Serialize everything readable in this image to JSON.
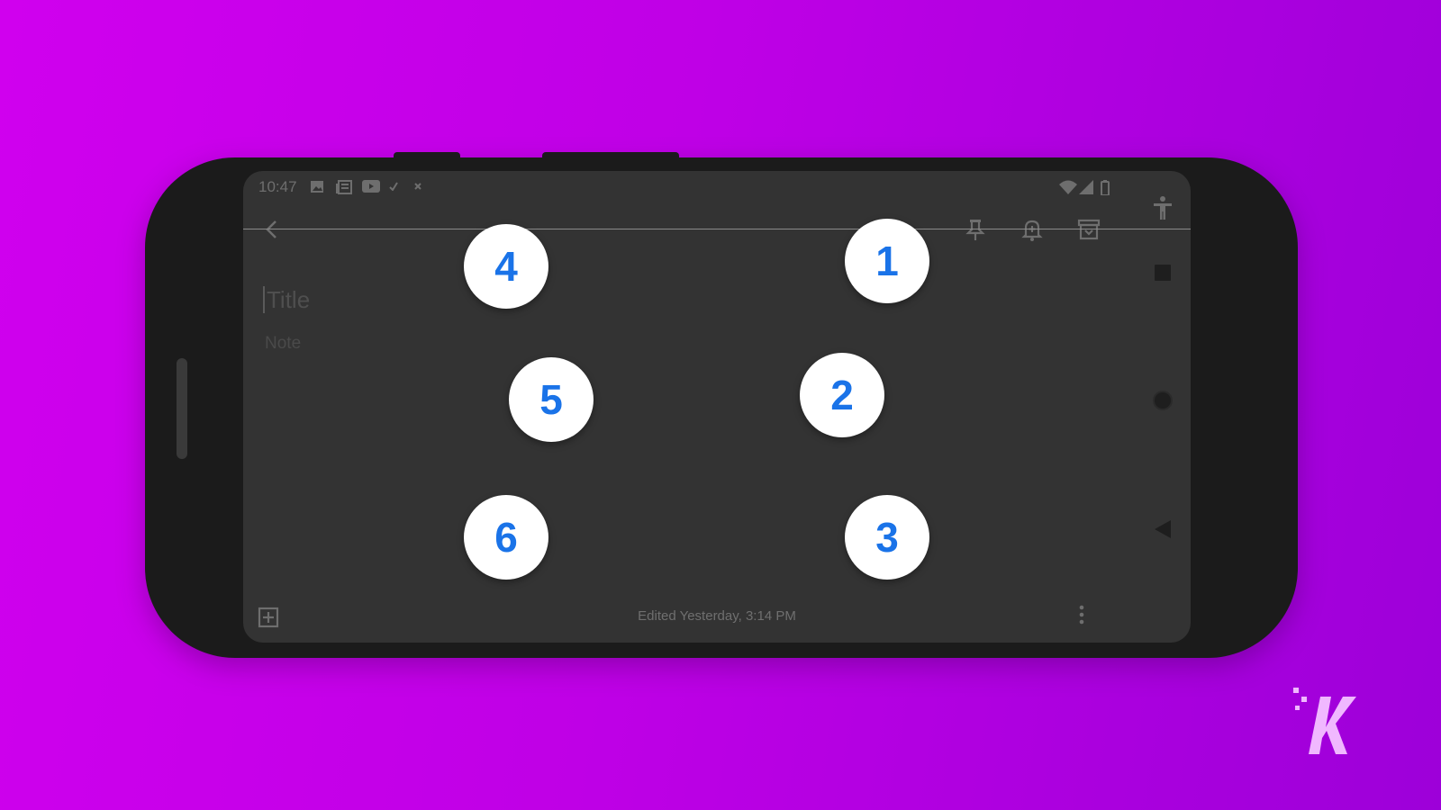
{
  "statusbar": {
    "time": "10:47"
  },
  "note": {
    "title_placeholder": "Title",
    "body_placeholder": "Note"
  },
  "footer": {
    "edited": "Edited Yesterday, 3:14 PM"
  },
  "braille_dots": {
    "d1": "1",
    "d2": "2",
    "d3": "3",
    "d4": "4",
    "d5": "5",
    "d6": "6"
  },
  "icons": {
    "status": [
      "image-icon",
      "news-icon",
      "youtube-icon",
      "check-icon",
      "close-icon",
      "wifi-icon",
      "signal-icon",
      "battery-icon"
    ],
    "toolbar": [
      "back-arrow-icon",
      "pin-icon",
      "reminder-bell-icon",
      "archive-icon",
      "accessibility-icon"
    ],
    "nav": [
      "recents-square-icon",
      "home-circle-icon",
      "back-triangle-icon"
    ],
    "bottom": [
      "add-box-icon",
      "more-vert-icon"
    ]
  },
  "colors": {
    "background": "#c800ea",
    "screen": "#333333",
    "dot_number": "#1a73e8",
    "logo": "#f0b8ff"
  },
  "logo": {
    "text": "K"
  }
}
